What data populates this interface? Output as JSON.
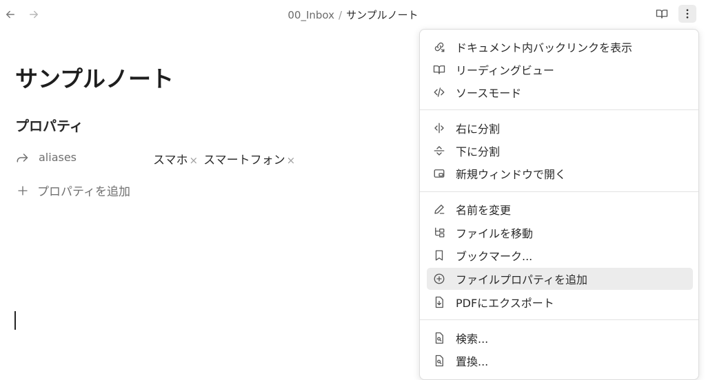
{
  "breadcrumb": {
    "folder": "00_Inbox",
    "separator": "/",
    "file": "サンプルノート"
  },
  "note": {
    "title": "サンプルノート",
    "properties_heading": "プロパティ",
    "property": {
      "key": "aliases",
      "values": [
        "スマホ",
        "スマートフォン"
      ],
      "remove_glyph": "×"
    },
    "add_property_label": "プロパティを追加"
  },
  "menu": {
    "items": [
      {
        "label": "ドキュメント内バックリンクを表示",
        "icon": "backlink-icon"
      },
      {
        "label": "リーディングビュー",
        "icon": "book-open-icon"
      },
      {
        "label": "ソースモード",
        "icon": "code-icon"
      },
      {
        "label": "右に分割",
        "icon": "split-right-icon"
      },
      {
        "label": "下に分割",
        "icon": "split-down-icon"
      },
      {
        "label": "新規ウィンドウで開く",
        "icon": "new-window-icon"
      },
      {
        "label": "名前を変更",
        "icon": "pencil-icon"
      },
      {
        "label": "ファイルを移動",
        "icon": "folder-move-icon"
      },
      {
        "label": "ブックマーク...",
        "icon": "bookmark-icon"
      },
      {
        "label": "ファイルプロパティを追加",
        "icon": "plus-circle-icon"
      },
      {
        "label": "PDFにエクスポート",
        "icon": "export-pdf-icon"
      },
      {
        "label": "検索...",
        "icon": "search-file-icon"
      },
      {
        "label": "置換...",
        "icon": "replace-file-icon"
      }
    ]
  },
  "colors": {
    "menu_hover": "#ececec",
    "text": "#2a2a2a",
    "muted": "#6f6f6f"
  }
}
